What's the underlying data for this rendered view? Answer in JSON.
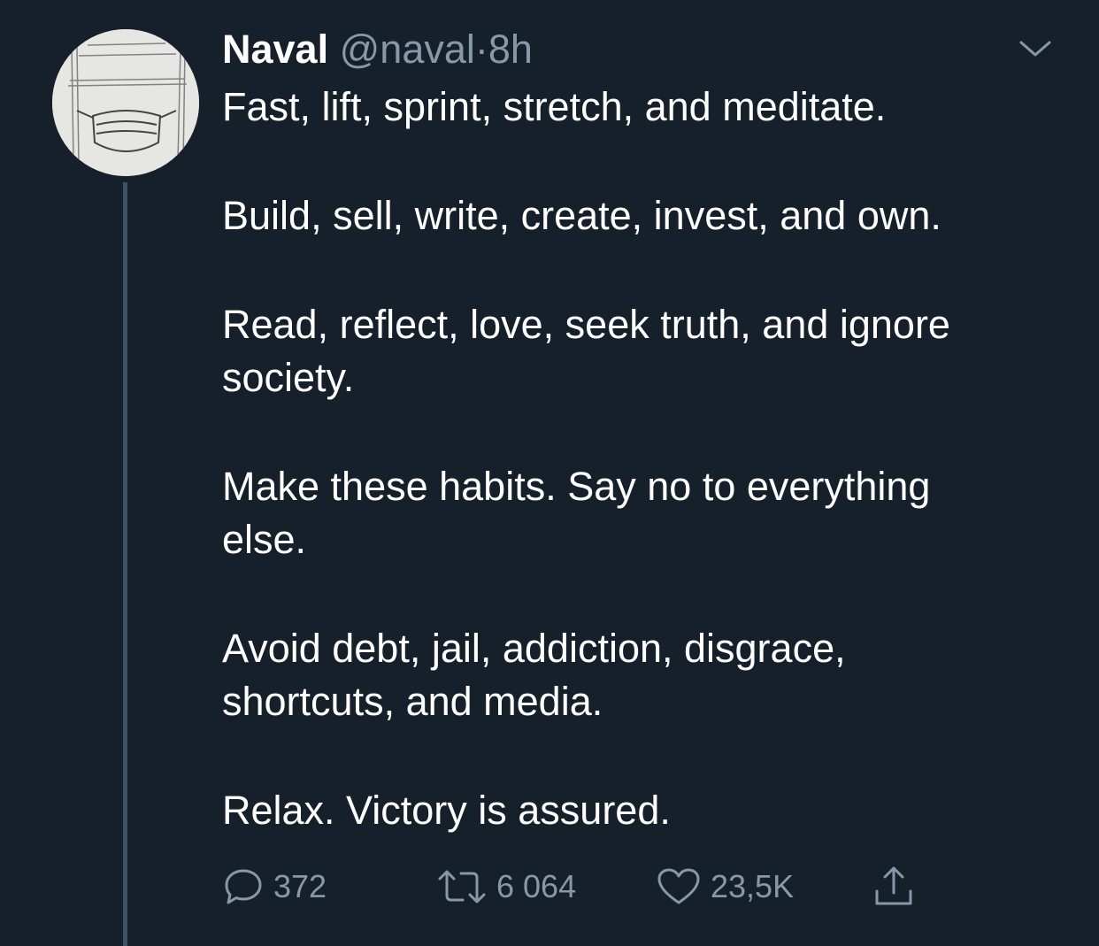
{
  "tweet": {
    "author_name": "Naval",
    "handle": "@naval",
    "separator": "·",
    "time": "8h",
    "paragraphs": [
      "Fast, lift, sprint, stretch, and meditate.",
      "Build, sell, write, create, invest, and own.",
      "Read, reflect, love, seek truth, and ignore\nsociety.",
      "Make these habits. Say no to everything\nelse.",
      "Avoid debt, jail, addiction, disgrace,\nshortcuts, and media.",
      "Relax. Victory is assured."
    ]
  },
  "actions": {
    "replies": "372",
    "retweets": "6 064",
    "likes": "23,5K"
  },
  "icons": {
    "reply": "reply-icon",
    "retweet": "retweet-icon",
    "like": "heart-icon",
    "share": "share-icon",
    "menu": "chevron-down-icon"
  },
  "colors": {
    "background": "#15202b",
    "text": "#ffffff",
    "secondary": "#8899a6",
    "thread_line": "#3d5466"
  }
}
